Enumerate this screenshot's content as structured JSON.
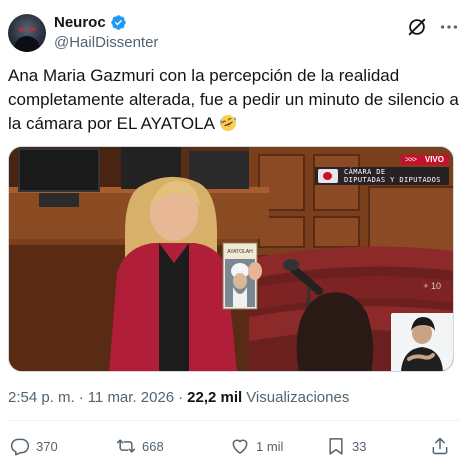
{
  "author": {
    "display_name": "Neuroc",
    "handle": "@HailDissenter",
    "verified": true
  },
  "tweet": {
    "text": "Ana Maria Gazmuri con la percepción de la realidad completamente alterada, fue a pedir un minuto de silencio a la cámara por EL AYATOLA",
    "emoji": "rolling-on-floor-laughing"
  },
  "media": {
    "type": "video-still",
    "live_badge": "VIVO",
    "live_arrows": ">>>",
    "channel_name_line1": "CÁMARA DE",
    "channel_name_line2": "DIPUTADAS Y DIPUTADOS",
    "overlay_number": "+ 10",
    "portrait_caption": "AYATOLAH"
  },
  "meta": {
    "time": "2:54 p. m.",
    "separator": "·",
    "date": "11 mar. 2026",
    "views_count": "22,2 mil",
    "views_label": "Visualizaciones"
  },
  "actions": {
    "replies": "370",
    "retweets": "668",
    "likes": "1 mil",
    "bookmarks": "33"
  },
  "colors": {
    "text": "#0f1419",
    "secondary": "#536471",
    "verified": "#1d9bf0",
    "live_red": "#c8102e"
  },
  "icons": [
    "verified-badge-icon",
    "grok-icon",
    "more-icon",
    "reply-icon",
    "retweet-icon",
    "like-icon",
    "bookmark-icon",
    "share-icon"
  ]
}
